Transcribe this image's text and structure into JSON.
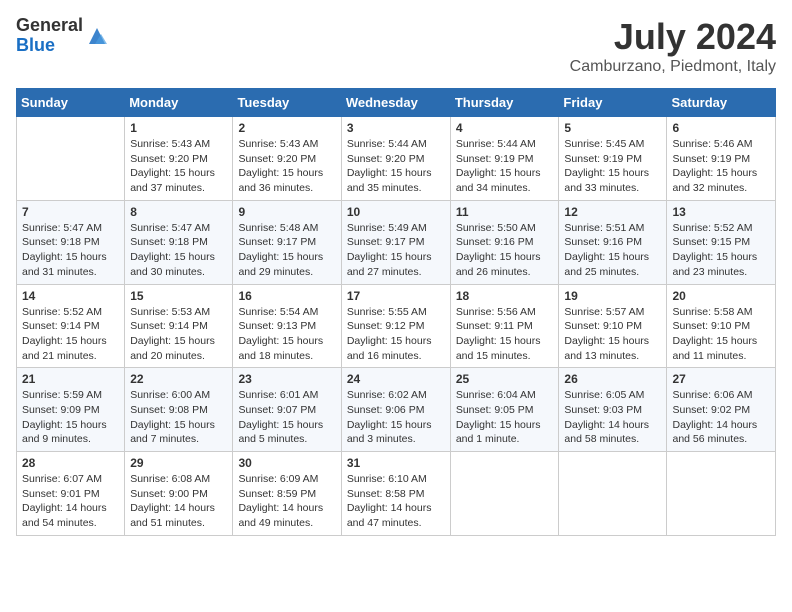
{
  "header": {
    "logo_general": "General",
    "logo_blue": "Blue",
    "title": "July 2024",
    "subtitle": "Camburzano, Piedmont, Italy"
  },
  "calendar": {
    "days_of_week": [
      "Sunday",
      "Monday",
      "Tuesday",
      "Wednesday",
      "Thursday",
      "Friday",
      "Saturday"
    ],
    "weeks": [
      [
        {
          "day": "",
          "content": ""
        },
        {
          "day": "1",
          "content": "Sunrise: 5:43 AM\nSunset: 9:20 PM\nDaylight: 15 hours\nand 37 minutes."
        },
        {
          "day": "2",
          "content": "Sunrise: 5:43 AM\nSunset: 9:20 PM\nDaylight: 15 hours\nand 36 minutes."
        },
        {
          "day": "3",
          "content": "Sunrise: 5:44 AM\nSunset: 9:20 PM\nDaylight: 15 hours\nand 35 minutes."
        },
        {
          "day": "4",
          "content": "Sunrise: 5:44 AM\nSunset: 9:19 PM\nDaylight: 15 hours\nand 34 minutes."
        },
        {
          "day": "5",
          "content": "Sunrise: 5:45 AM\nSunset: 9:19 PM\nDaylight: 15 hours\nand 33 minutes."
        },
        {
          "day": "6",
          "content": "Sunrise: 5:46 AM\nSunset: 9:19 PM\nDaylight: 15 hours\nand 32 minutes."
        }
      ],
      [
        {
          "day": "7",
          "content": "Sunrise: 5:47 AM\nSunset: 9:18 PM\nDaylight: 15 hours\nand 31 minutes."
        },
        {
          "day": "8",
          "content": "Sunrise: 5:47 AM\nSunset: 9:18 PM\nDaylight: 15 hours\nand 30 minutes."
        },
        {
          "day": "9",
          "content": "Sunrise: 5:48 AM\nSunset: 9:17 PM\nDaylight: 15 hours\nand 29 minutes."
        },
        {
          "day": "10",
          "content": "Sunrise: 5:49 AM\nSunset: 9:17 PM\nDaylight: 15 hours\nand 27 minutes."
        },
        {
          "day": "11",
          "content": "Sunrise: 5:50 AM\nSunset: 9:16 PM\nDaylight: 15 hours\nand 26 minutes."
        },
        {
          "day": "12",
          "content": "Sunrise: 5:51 AM\nSunset: 9:16 PM\nDaylight: 15 hours\nand 25 minutes."
        },
        {
          "day": "13",
          "content": "Sunrise: 5:52 AM\nSunset: 9:15 PM\nDaylight: 15 hours\nand 23 minutes."
        }
      ],
      [
        {
          "day": "14",
          "content": "Sunrise: 5:52 AM\nSunset: 9:14 PM\nDaylight: 15 hours\nand 21 minutes."
        },
        {
          "day": "15",
          "content": "Sunrise: 5:53 AM\nSunset: 9:14 PM\nDaylight: 15 hours\nand 20 minutes."
        },
        {
          "day": "16",
          "content": "Sunrise: 5:54 AM\nSunset: 9:13 PM\nDaylight: 15 hours\nand 18 minutes."
        },
        {
          "day": "17",
          "content": "Sunrise: 5:55 AM\nSunset: 9:12 PM\nDaylight: 15 hours\nand 16 minutes."
        },
        {
          "day": "18",
          "content": "Sunrise: 5:56 AM\nSunset: 9:11 PM\nDaylight: 15 hours\nand 15 minutes."
        },
        {
          "day": "19",
          "content": "Sunrise: 5:57 AM\nSunset: 9:10 PM\nDaylight: 15 hours\nand 13 minutes."
        },
        {
          "day": "20",
          "content": "Sunrise: 5:58 AM\nSunset: 9:10 PM\nDaylight: 15 hours\nand 11 minutes."
        }
      ],
      [
        {
          "day": "21",
          "content": "Sunrise: 5:59 AM\nSunset: 9:09 PM\nDaylight: 15 hours\nand 9 minutes."
        },
        {
          "day": "22",
          "content": "Sunrise: 6:00 AM\nSunset: 9:08 PM\nDaylight: 15 hours\nand 7 minutes."
        },
        {
          "day": "23",
          "content": "Sunrise: 6:01 AM\nSunset: 9:07 PM\nDaylight: 15 hours\nand 5 minutes."
        },
        {
          "day": "24",
          "content": "Sunrise: 6:02 AM\nSunset: 9:06 PM\nDaylight: 15 hours\nand 3 minutes."
        },
        {
          "day": "25",
          "content": "Sunrise: 6:04 AM\nSunset: 9:05 PM\nDaylight: 15 hours\nand 1 minute."
        },
        {
          "day": "26",
          "content": "Sunrise: 6:05 AM\nSunset: 9:03 PM\nDaylight: 14 hours\nand 58 minutes."
        },
        {
          "day": "27",
          "content": "Sunrise: 6:06 AM\nSunset: 9:02 PM\nDaylight: 14 hours\nand 56 minutes."
        }
      ],
      [
        {
          "day": "28",
          "content": "Sunrise: 6:07 AM\nSunset: 9:01 PM\nDaylight: 14 hours\nand 54 minutes."
        },
        {
          "day": "29",
          "content": "Sunrise: 6:08 AM\nSunset: 9:00 PM\nDaylight: 14 hours\nand 51 minutes."
        },
        {
          "day": "30",
          "content": "Sunrise: 6:09 AM\nSunset: 8:59 PM\nDaylight: 14 hours\nand 49 minutes."
        },
        {
          "day": "31",
          "content": "Sunrise: 6:10 AM\nSunset: 8:58 PM\nDaylight: 14 hours\nand 47 minutes."
        },
        {
          "day": "",
          "content": ""
        },
        {
          "day": "",
          "content": ""
        },
        {
          "day": "",
          "content": ""
        }
      ]
    ]
  }
}
